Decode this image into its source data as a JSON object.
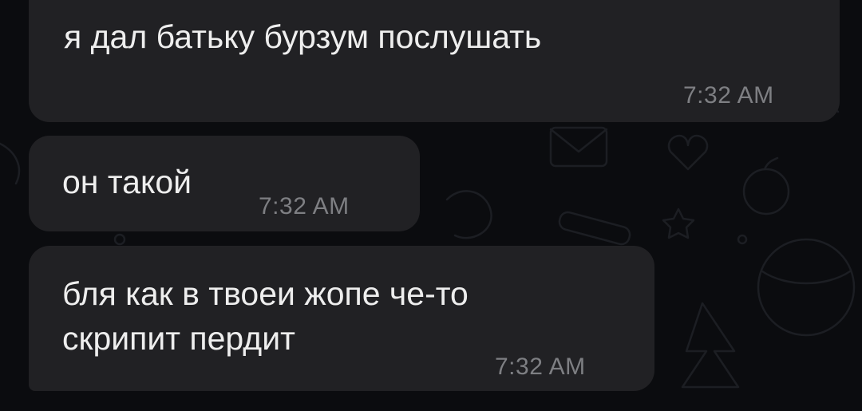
{
  "chat": {
    "messages": [
      {
        "text": "я дал батьку бурзум послушать",
        "time": "7:32 AM"
      },
      {
        "text": "он такой",
        "time": "7:32 AM"
      },
      {
        "text": "бля как в твоеи жопе че-то\nскрипит пердит",
        "time": "7:32 AM"
      }
    ]
  },
  "theme": {
    "background": "#0b0c0f",
    "bubble": "#212124",
    "text": "#eeeeee",
    "time": "#7e7f83"
  }
}
